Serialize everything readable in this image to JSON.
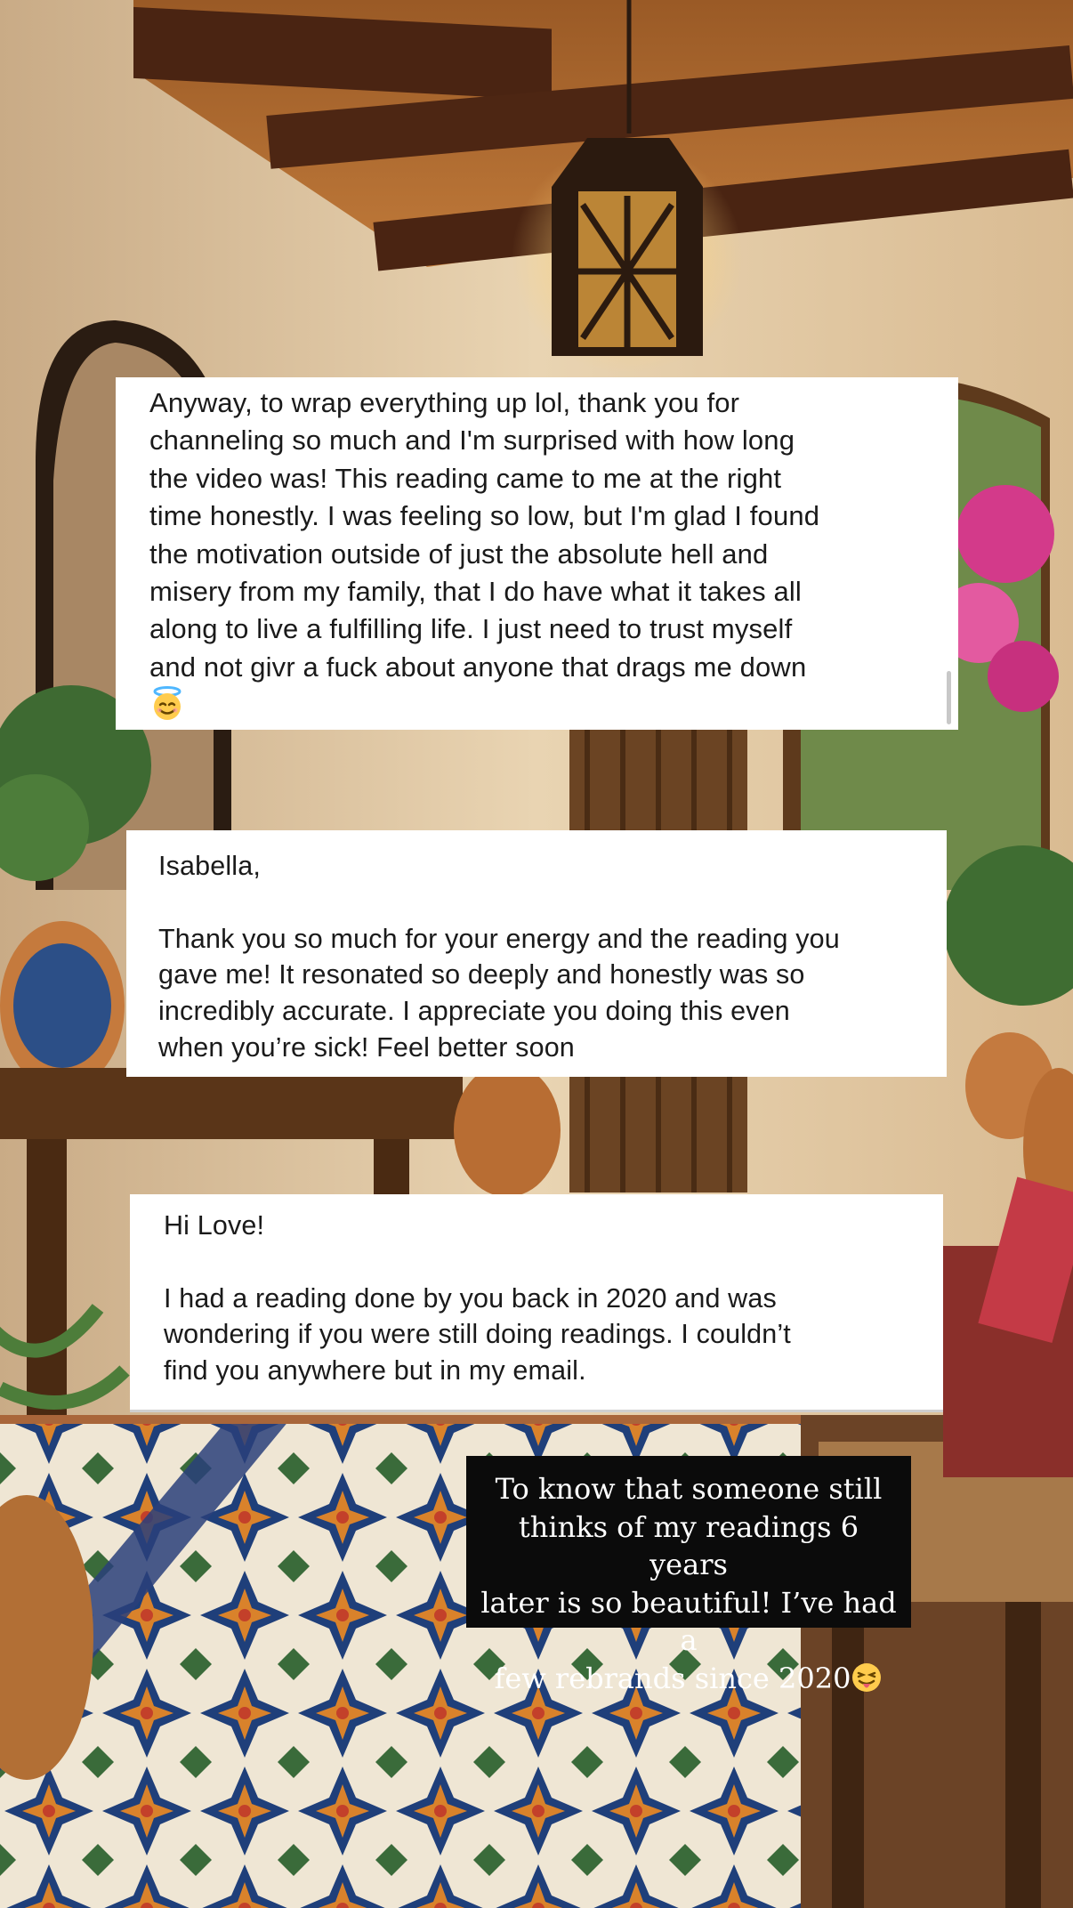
{
  "messages": [
    {
      "body": "Anyway, to wrap everything up lol, thank you for\nchanneling so much and I'm surprised with how long\nthe video was! This reading came to me at the right\ntime honestly. I was feeling so low, but I'm glad I found\nthe motivation outside of just the absolute hell and\nmisery from my family, that I do have what it takes all\nalong to live a fulfilling life. I just need to trust myself\nand not givr a fuck about anyone that drags me down",
      "emoji": "smiling-face-with-halo"
    },
    {
      "greeting": "Isabella,",
      "body": "Thank you so much for your energy and the reading you\ngave me! It resonated so deeply and honestly was so\nincredibly accurate. I appreciate you doing this even\nwhen you’re sick! Feel better soon"
    },
    {
      "greeting": "Hi Love!",
      "body": "I had a reading done by you back in 2020 and was\nwondering if you were still doing readings. I couldn’t\nfind you anywhere but in my email."
    }
  ],
  "caption": {
    "text": "To know that someone still\nthinks of my readings 6 years\nlater is so beautiful! I’ve had a\nfew rebrands since 2020",
    "emoji": "winking-face-with-tongue"
  },
  "colors": {
    "card_background": "#ffffff",
    "caption_background": "#0b0b0b",
    "caption_text": "#ffffff"
  }
}
